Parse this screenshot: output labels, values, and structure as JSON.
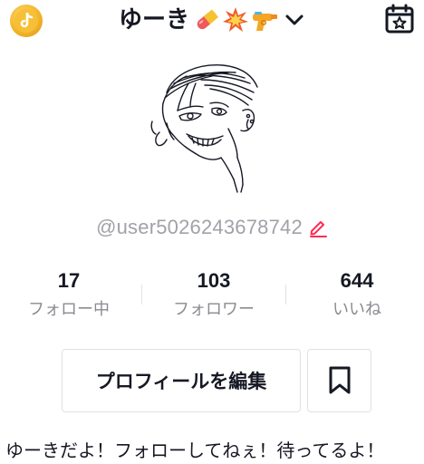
{
  "header": {
    "title": "ゆーき",
    "title_emojis": [
      "pill-emoji",
      "collision-emoji",
      "water-pistol-emoji"
    ],
    "left_icon": "tiktok-coin-icon",
    "right_icon": "calendar-star-icon",
    "dropdown_icon": "chevron-down-icon"
  },
  "profile": {
    "avatar": "manga-portrait-avatar",
    "username": "@user5026243678742",
    "edit_icon": "pencil-icon"
  },
  "stats": [
    {
      "value": "17",
      "label": "フォロー中"
    },
    {
      "value": "103",
      "label": "フォロワー"
    },
    {
      "value": "644",
      "label": "いいね"
    }
  ],
  "actions": {
    "edit_profile_label": "プロフィールを編集",
    "bookmark_icon": "bookmark-icon"
  },
  "bio": "ゆーきだよ！フォローしてねぇ！待ってるよ！",
  "colors": {
    "accent": "#fe2c55",
    "muted_text": "#8a8b91",
    "username_text": "#a0a2a8",
    "coin": "#f3b52a"
  }
}
